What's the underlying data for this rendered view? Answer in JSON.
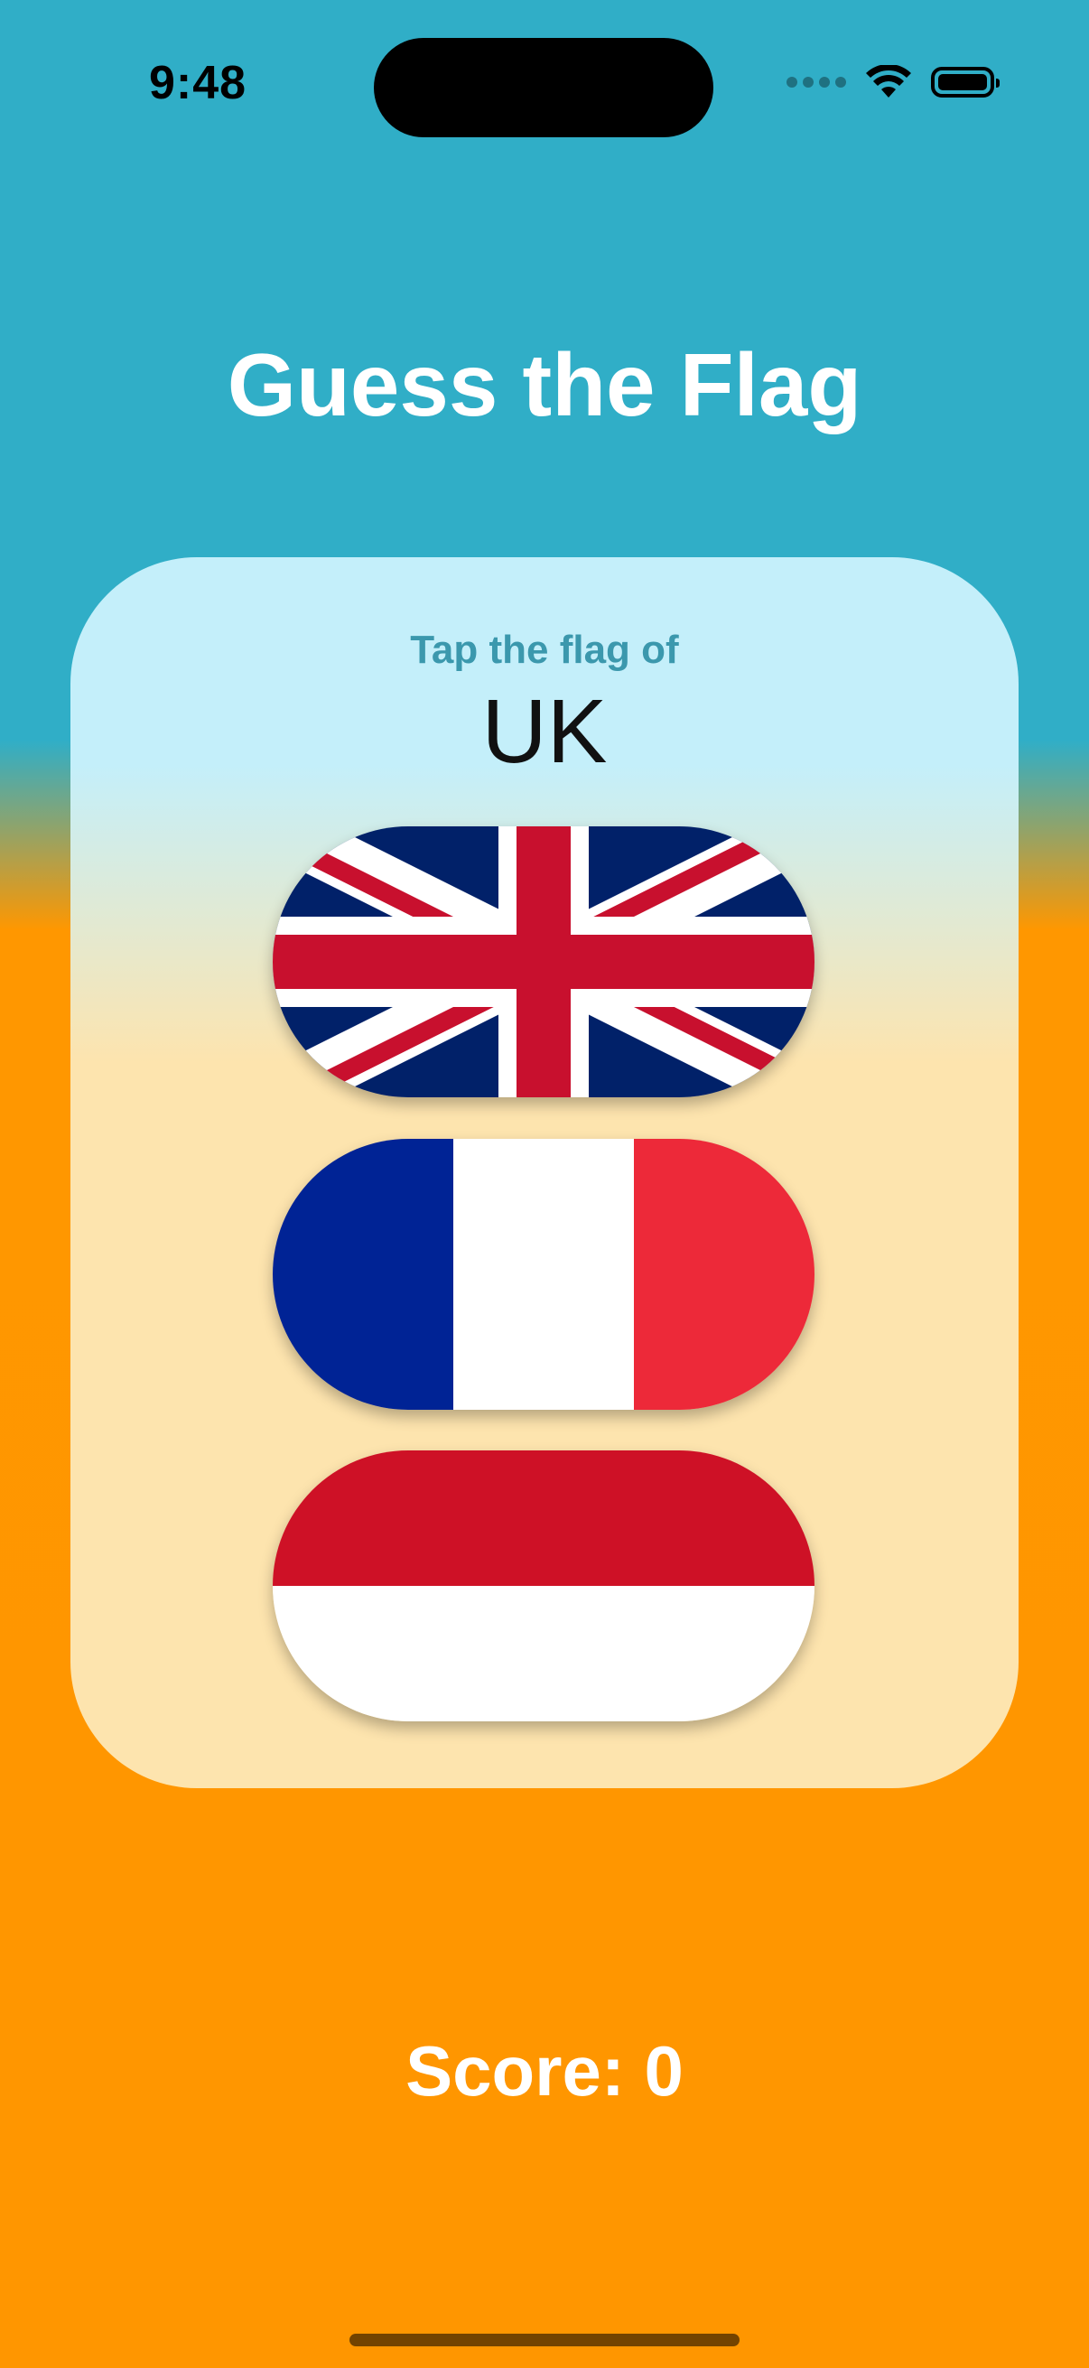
{
  "status_bar": {
    "time": "9:48",
    "icons": [
      "signal-dots-icon",
      "wifi-icon",
      "battery-icon"
    ]
  },
  "title": "Guess the Flag",
  "card": {
    "prompt": "Tap the flag of",
    "country": "UK",
    "flags": [
      {
        "name": "United Kingdom",
        "colors": [
          "#012169",
          "#ffffff",
          "#c8102e"
        ]
      },
      {
        "name": "France",
        "colors": [
          "#002395",
          "#ffffff",
          "#ed2939"
        ]
      },
      {
        "name": "Monaco",
        "colors": [
          "#ce1126",
          "#ffffff"
        ]
      }
    ]
  },
  "score_text": "Score: 0",
  "colors": {
    "background_top": "#30aec7",
    "background_bottom": "#ff9600",
    "card_top": "#c4effa",
    "card_bottom": "#fde4ae",
    "prompt": "#3b98ad"
  }
}
